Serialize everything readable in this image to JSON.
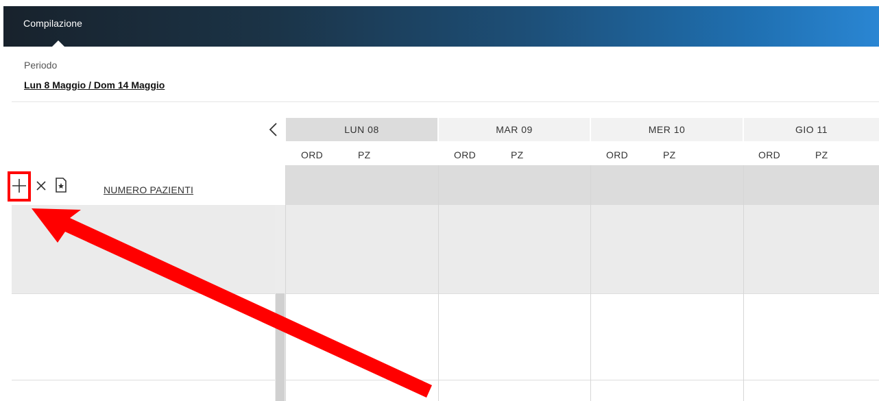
{
  "header": {
    "tab_label": "Compilazione"
  },
  "period": {
    "label": "Periodo",
    "value": "Lun 8 Maggio / Dom 14 Maggio"
  },
  "schedule": {
    "days": [
      {
        "label": "LUN 08",
        "active": true
      },
      {
        "label": "MAR 09",
        "active": false
      },
      {
        "label": "MER 10",
        "active": false
      },
      {
        "label": "GIO 11",
        "active": false
      }
    ],
    "sub_columns": [
      "ORD",
      "PZ"
    ],
    "row_label": "NUMERO PAZIENTI"
  },
  "toolbar": {
    "add_icon": "plus-icon",
    "remove_icon": "x-icon",
    "document_icon": "document-star-icon"
  },
  "colors": {
    "annotation_red": "#ff0000",
    "active_day_bg": "#dcdcdc",
    "header_bar_start": "#18222c",
    "header_bar_end": "#2a86d3"
  }
}
